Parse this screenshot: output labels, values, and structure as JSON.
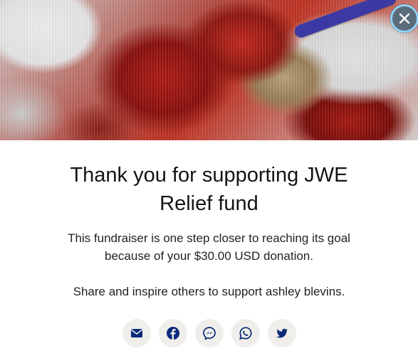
{
  "hero": {
    "image_icon": "fundraiser-photo"
  },
  "close_button": {
    "icon": "close-icon",
    "accent_border": "#8fd3f4"
  },
  "title": "Thank you for supporting JWE Relief fund",
  "message": "This fundraiser is one step closer to reaching its goal because of your $30.00 USD donation.",
  "share_prompt": "Share and inspire others to support ashley blevins.",
  "share_buttons": [
    {
      "name": "email",
      "icon": "mail-icon"
    },
    {
      "name": "facebook",
      "icon": "facebook-icon"
    },
    {
      "name": "messenger",
      "icon": "messenger-icon"
    },
    {
      "name": "whatsapp",
      "icon": "whatsapp-icon"
    },
    {
      "name": "twitter",
      "icon": "twitter-icon"
    }
  ],
  "colors": {
    "icon_navy": "#0b2a7a",
    "button_bg": "#f0eeeb"
  }
}
